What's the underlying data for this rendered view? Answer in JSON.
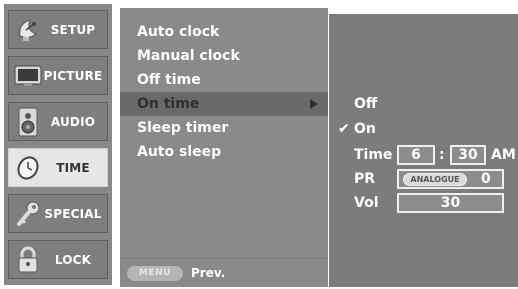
{
  "sidebar": {
    "items": [
      {
        "label": "SETUP",
        "icon": "satellite-dish-icon"
      },
      {
        "label": "PICTURE",
        "icon": "tv-screen-icon"
      },
      {
        "label": "AUDIO",
        "icon": "speaker-icon"
      },
      {
        "label": "TIME",
        "icon": "clock-icon",
        "active": true
      },
      {
        "label": "SPECIAL",
        "icon": "key-icon"
      },
      {
        "label": "LOCK",
        "icon": "padlock-icon"
      }
    ]
  },
  "menu": {
    "items": [
      {
        "label": "Auto clock"
      },
      {
        "label": "Manual clock"
      },
      {
        "label": "Off time"
      },
      {
        "label": "On time",
        "highlighted": true
      },
      {
        "label": "Sleep timer"
      },
      {
        "label": "Auto sleep"
      }
    ],
    "footer": {
      "key_label": "MENU",
      "prev_label": "Prev."
    }
  },
  "submenu": {
    "off_label": "Off",
    "on_label": "On",
    "on_checked": true,
    "check_glyph": "✔",
    "time": {
      "label": "Time",
      "hour": "6",
      "separator": ":",
      "minute": "30",
      "ampm": "AM"
    },
    "pr": {
      "label": "PR",
      "band": "ANALOGUE",
      "value": "0"
    },
    "vol": {
      "label": "Vol",
      "value": "30"
    }
  },
  "colors": {
    "sidebar_bg": "#888888",
    "menu_bg": "#8a8a8a",
    "sub_bg": "#7c7c7c",
    "highlight": "#6a6a6a",
    "text": "#ffffff"
  }
}
